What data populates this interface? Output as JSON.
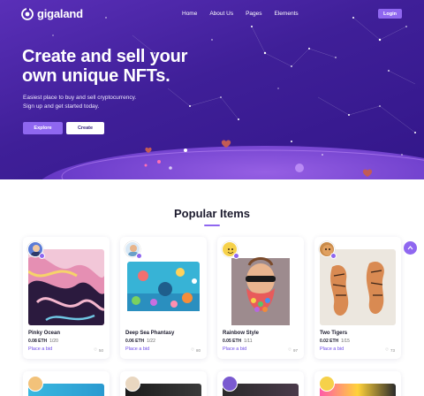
{
  "brand": {
    "name": "gigaland"
  },
  "nav": {
    "links": [
      "Home",
      "About Us",
      "Pages",
      "Elements"
    ],
    "login_label": "Login"
  },
  "hero": {
    "title": "Create and sell your own unique NFTs.",
    "subtitle_line1": "Easiest place to buy and sell cryptocurrency.",
    "subtitle_line2": "Sign up and get started today.",
    "explore_label": "Explore",
    "create_label": "Create"
  },
  "section": {
    "title": "Popular Items"
  },
  "items": [
    {
      "name": "Pinky Ocean",
      "price": "0.08 ETH",
      "count": "1/20",
      "bid_label": "Place a bid",
      "likes": "50"
    },
    {
      "name": "Deep Sea Phantasy",
      "price": "0.06 ETH",
      "count": "1/22",
      "bid_label": "Place a bid",
      "likes": "80"
    },
    {
      "name": "Rainbow Style",
      "price": "0.05 ETH",
      "count": "1/11",
      "bid_label": "Place a bid",
      "likes": "97"
    },
    {
      "name": "Two Tigers",
      "price": "0.02 ETH",
      "count": "1/15",
      "bid_label": "Place a bid",
      "likes": "73"
    }
  ],
  "colors": {
    "accent": "#8f67f0",
    "hero_bg": "#3f1f98",
    "link": "#6d4ae6"
  },
  "icons": [
    "logo-swirl-icon",
    "heart-icon",
    "verified-icon",
    "arrow-up-icon"
  ]
}
